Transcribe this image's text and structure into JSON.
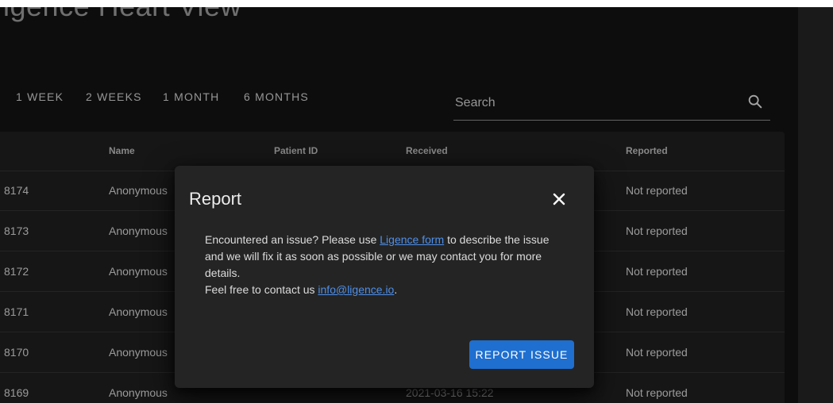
{
  "app": {
    "title": "igence Heart View"
  },
  "range_tabs": [
    "1 WEEK",
    "2 WEEKS",
    "1 MONTH",
    "6 MONTHS"
  ],
  "search": {
    "placeholder": "Search",
    "icon": "search-icon"
  },
  "table": {
    "headers": {
      "name": "Name",
      "patient_id": "Patient ID",
      "received": "Received",
      "reported": "Reported"
    },
    "rows": [
      {
        "id": "8174",
        "name": "Anonymous",
        "received": "",
        "reported": "Not reported"
      },
      {
        "id": "8173",
        "name": "Anonymous",
        "received": "",
        "reported": "Not reported"
      },
      {
        "id": "8172",
        "name": "Anonymous",
        "received": "",
        "reported": "Not reported"
      },
      {
        "id": "8171",
        "name": "Anonymous",
        "received": "",
        "reported": "Not reported"
      },
      {
        "id": "8170",
        "name": "Anonymous",
        "received": "",
        "reported": "Not reported"
      },
      {
        "id": "8169",
        "name": "Anonymous",
        "received": "2021-03-16 15:22",
        "reported": "Not reported"
      }
    ]
  },
  "dialog": {
    "title": "Report",
    "close_icon": "close-icon",
    "body": {
      "line1_before": "Encountered an issue? Please use ",
      "link_form": "Ligence form",
      "line1_after": " to describe the issue and we will fix it as soon as possible or we may contact you for more details.",
      "line2_before": "Feel free to contact us ",
      "link_email": "info@ligence.io",
      "line2_after": "."
    },
    "button_label": "REPORT ISSUE"
  },
  "colors": {
    "background": "#121212",
    "table_surface": "#1f1f1f",
    "dialog_surface": "#242424",
    "accent": "#1e6fd0",
    "link": "#4f8fe8"
  }
}
